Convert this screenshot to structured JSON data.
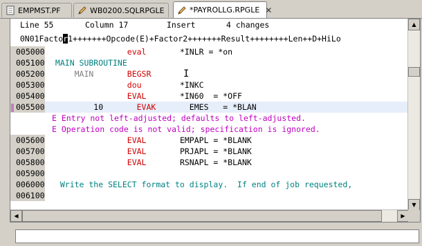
{
  "tabs": [
    {
      "label": "EMPMST.PF"
    },
    {
      "label": "WB0200.SQLRPGLE"
    },
    {
      "label": "*PAYROLLG.RPGLE",
      "close": "✕"
    }
  ],
  "status": {
    "line_label": "Line 55",
    "column_label": "Column 17",
    "mode": "Insert",
    "changes": "4 changes"
  },
  "ruler": {
    "prefix": "  0N01Facto",
    "cursor_char": "r",
    "suffix": "1+++++++Opcode(E)+Factor2+++++++Result++++++++Len++D+HiLo"
  },
  "lines": [
    {
      "seq": "005000",
      "code": "                eval       *INLR = *on",
      "type": "code"
    },
    {
      "seq": "005100",
      "code": " MAIN SUBROUTINE",
      "type": "comment"
    },
    {
      "seq": "005200",
      "code": "     MAIN       BEGSR",
      "type": "sub"
    },
    {
      "seq": "005300",
      "code": "                dou        *INKC",
      "type": "code"
    },
    {
      "seq": "005400",
      "code": "                EVAL       *IN60  = *OFF",
      "type": "code"
    },
    {
      "seq": "005500",
      "code": "         10       EVAK       EMES   = *BLAN",
      "type": "current"
    },
    {
      "seq": "",
      "code": "E Entry not left-adjusted; defaults to left-adjusted.",
      "type": "error"
    },
    {
      "seq": "",
      "code": "E Operation code is not valid; specification is ignored.",
      "type": "error"
    },
    {
      "seq": "005600",
      "code": "                EVAL       EMPAPL = *BLANK",
      "type": "code"
    },
    {
      "seq": "005700",
      "code": "                EVAL       PRJAPL = *BLANK",
      "type": "code"
    },
    {
      "seq": "005800",
      "code": "                EVAL       RSNAPL = *BLANK",
      "type": "code"
    },
    {
      "seq": "005900",
      "code": "",
      "type": "code"
    },
    {
      "seq": "006000",
      "code": "  Write the SELECT format to display.  If end of job requested,",
      "type": "comment"
    },
    {
      "seq": "006100",
      "code": "",
      "type": "code"
    }
  ],
  "colors": {
    "keyword": "#d00000",
    "comment": "#008080",
    "error": "#c000c0"
  }
}
